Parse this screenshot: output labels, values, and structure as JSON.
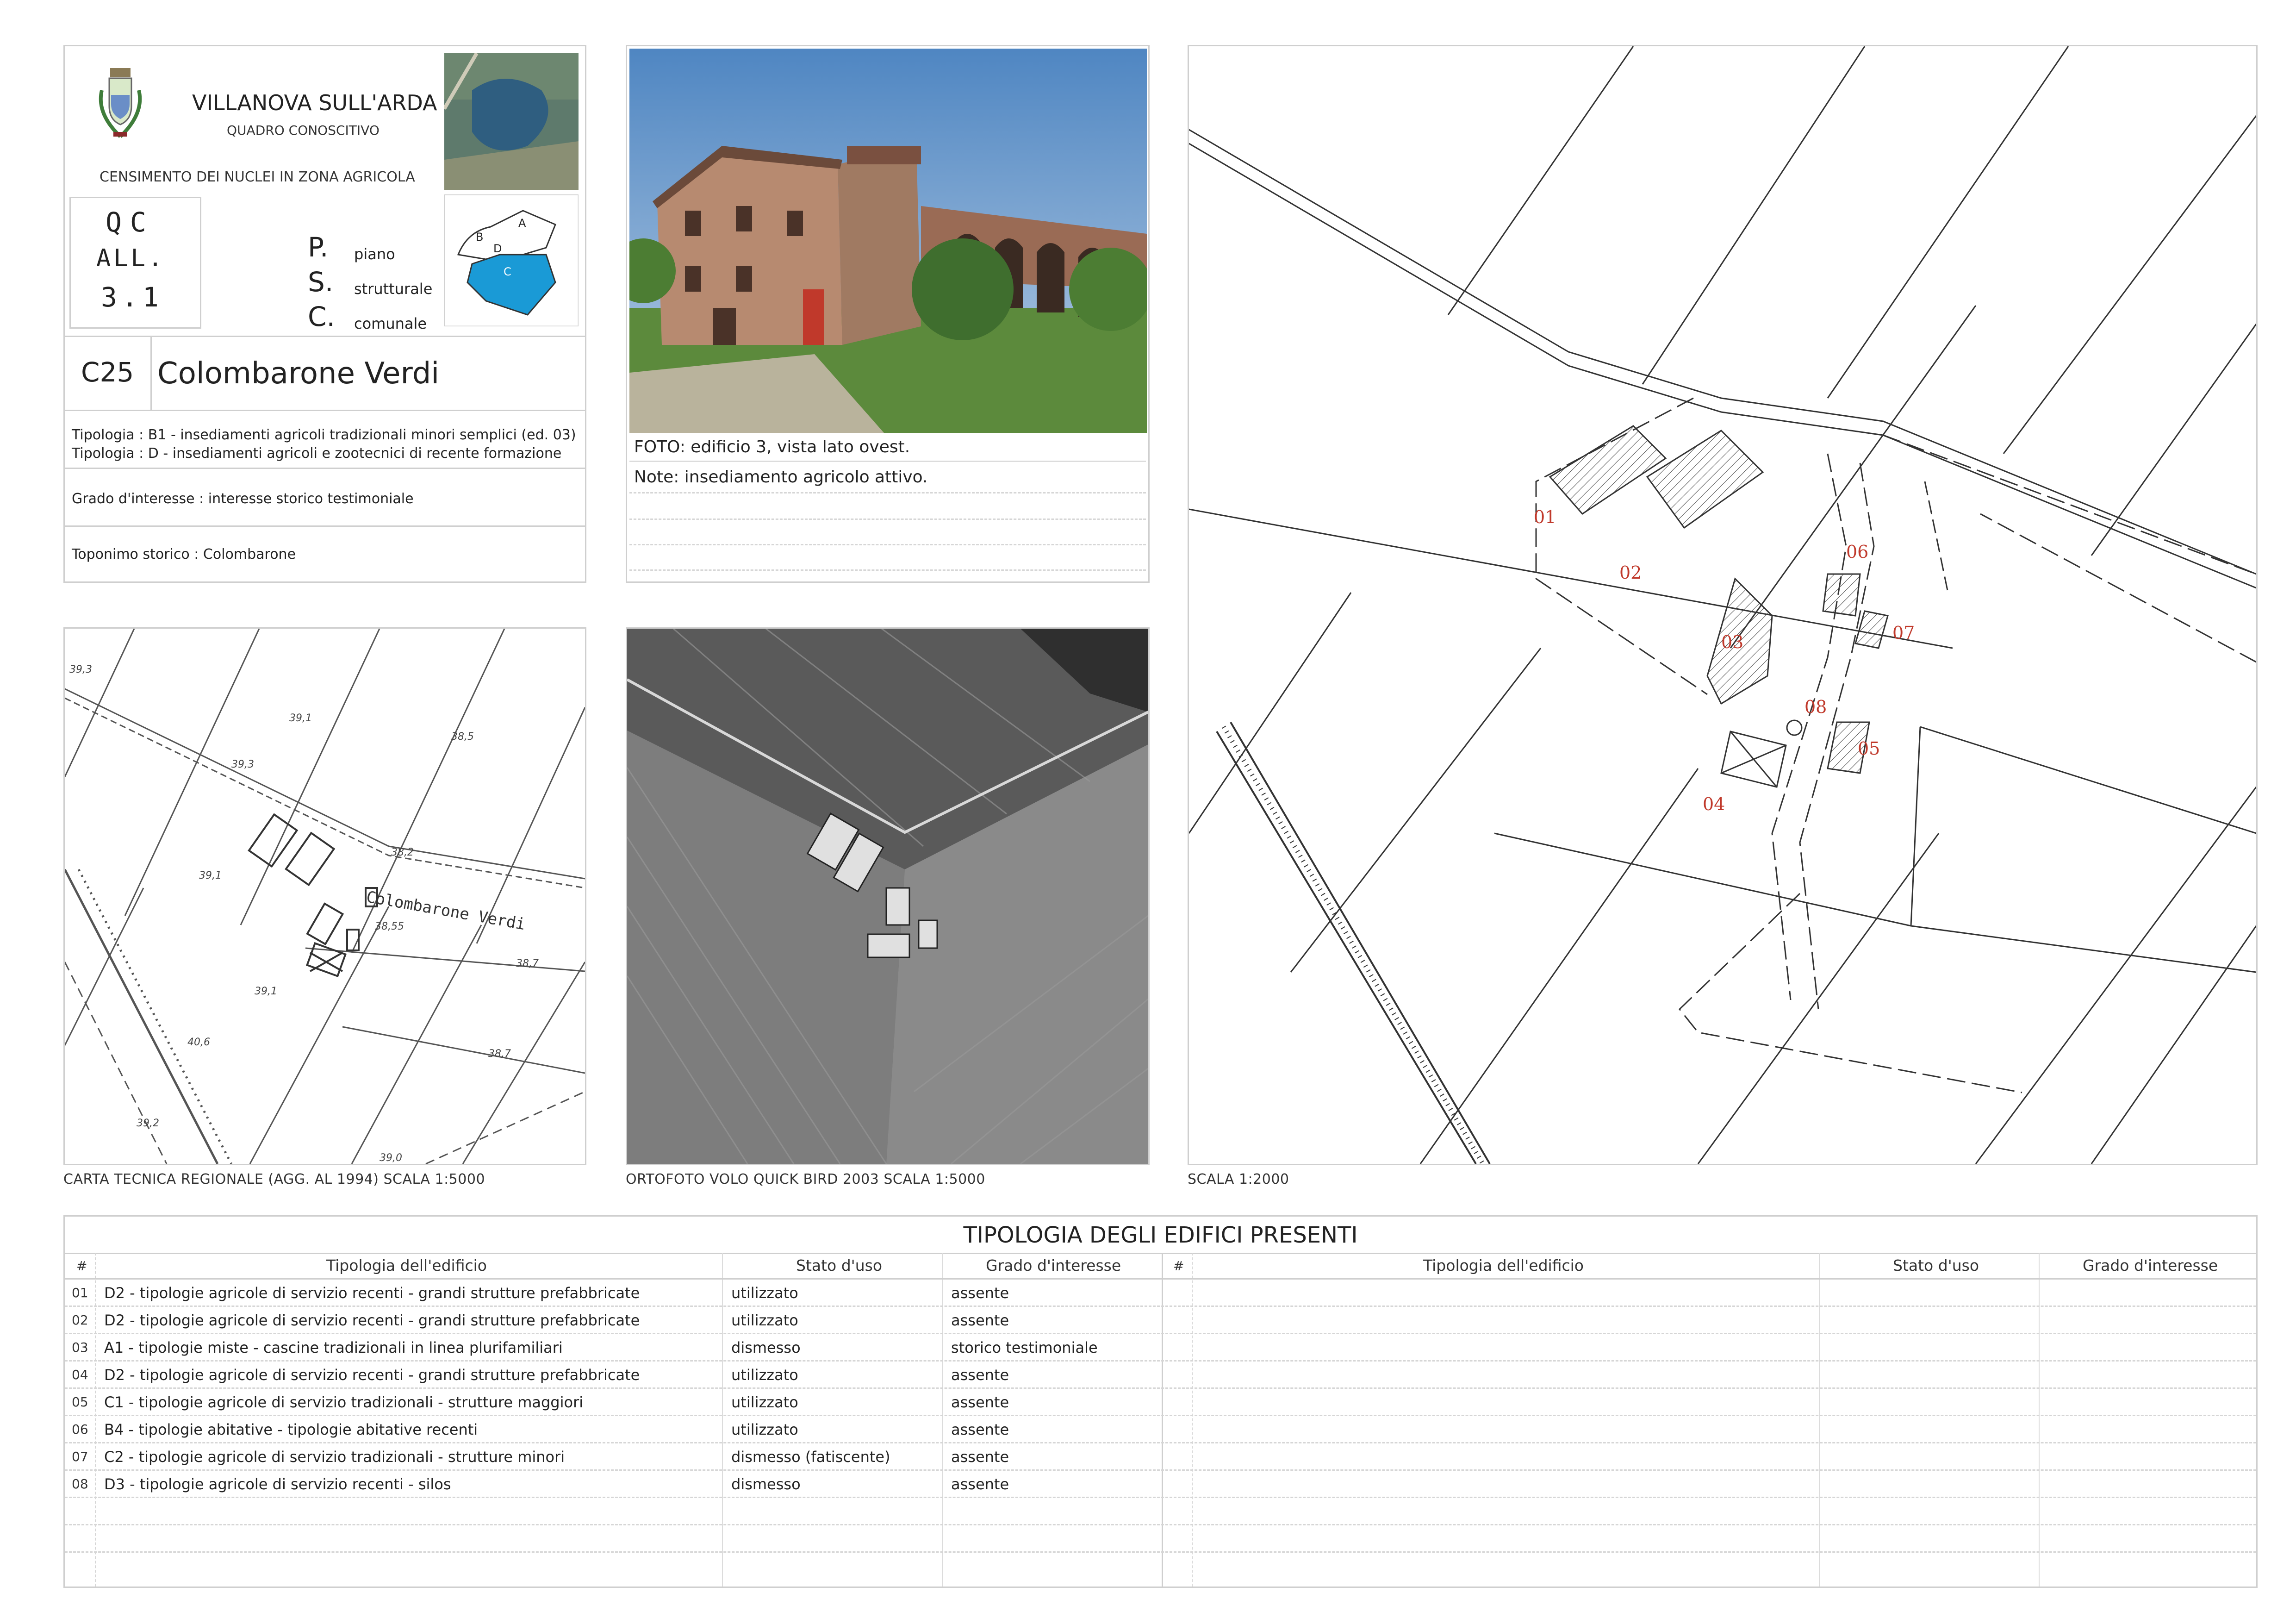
{
  "header": {
    "municipality": "VILLANOVA SULL'ARDA",
    "subtitle": "QUADRO CONOSCITIVO",
    "census_title": "CENSIMENTO DEI NUCLEI IN ZONA AGRICOLA",
    "qc_line1": "QC",
    "qc_line2": "ALL.",
    "qc_line3": "3.1",
    "psc": [
      {
        "letter": "P.",
        "word": "piano"
      },
      {
        "letter": "S.",
        "word": "strutturale"
      },
      {
        "letter": "C.",
        "word": "comunale"
      }
    ],
    "zone_map": {
      "labels": [
        "A",
        "B",
        "C",
        "D"
      ],
      "highlight_color": "#1a9ad6"
    }
  },
  "record": {
    "code": "C25",
    "name": "Colombarone Verdi",
    "tipologia_1": "Tipologia : B1 - insediamenti agricoli tradizionali minori semplici (ed. 03)",
    "tipologia_2": "Tipologia : D - insediamenti agricoli e zootecnici di recente formazione",
    "grado": "Grado d'interesse : interesse storico testimoniale",
    "toponimo": "Toponimo storico : Colombarone"
  },
  "photo": {
    "caption": "FOTO: edificio 3, vista lato ovest.",
    "note": "Note: insediamento agricolo attivo."
  },
  "maps": {
    "ctr_caption": "CARTA TECNICA REGIONALE (AGG. AL 1994) SCALA 1:5000",
    "ortho_caption": "ORTOFOTO VOLO QUICK BIRD 2003 SCALA 1:5000",
    "plan_caption": "SCALA 1:2000",
    "ctr_place_name": "Colombarone Verdi",
    "ctr_elevations": [
      "39,3",
      "39,1",
      "39,3",
      "38,5",
      "39,1",
      "38,2",
      "38,55",
      "38,7",
      "39,1",
      "40,6",
      "38,7",
      "39,2",
      "39,0"
    ],
    "plan_labels": [
      "01",
      "02",
      "03",
      "04",
      "05",
      "06",
      "07",
      "08"
    ]
  },
  "table": {
    "title": "TIPOLOGIA DEGLI EDIFICI PRESENTI",
    "headers": {
      "num": "#",
      "tipologia": "Tipologia dell'edificio",
      "stato": "Stato d'uso",
      "grado": "Grado d'interesse"
    },
    "rows": [
      {
        "num": "01",
        "tipologia": "D2 - tipologie agricole di servizio recenti - grandi strutture prefabbricate",
        "stato": "utilizzato",
        "grado": "assente"
      },
      {
        "num": "02",
        "tipologia": "D2 - tipologie agricole di servizio recenti - grandi strutture prefabbricate",
        "stato": "utilizzato",
        "grado": "assente"
      },
      {
        "num": "03",
        "tipologia": "A1 - tipologie miste - cascine tradizionali in linea plurifamiliari",
        "stato": "dismesso",
        "grado": "storico testimoniale"
      },
      {
        "num": "04",
        "tipologia": "D2 - tipologie agricole di servizio recenti - grandi strutture prefabbricate",
        "stato": "utilizzato",
        "grado": "assente"
      },
      {
        "num": "05",
        "tipologia": "C1 - tipologie agricole di servizio tradizionali - strutture maggiori",
        "stato": "utilizzato",
        "grado": "assente"
      },
      {
        "num": "06",
        "tipologia": "B4 - tipologie abitative - tipologie abitative recenti",
        "stato": "utilizzato",
        "grado": "assente"
      },
      {
        "num": "07",
        "tipologia": "C2 - tipologie agricole di servizio tradizionali - strutture minori",
        "stato": "dismesso (fatiscente)",
        "grado": "assente"
      },
      {
        "num": "08",
        "tipologia": "D3 - tipologie agricole di servizio recenti - silos",
        "stato": "dismesso",
        "grado": "assente"
      }
    ]
  }
}
